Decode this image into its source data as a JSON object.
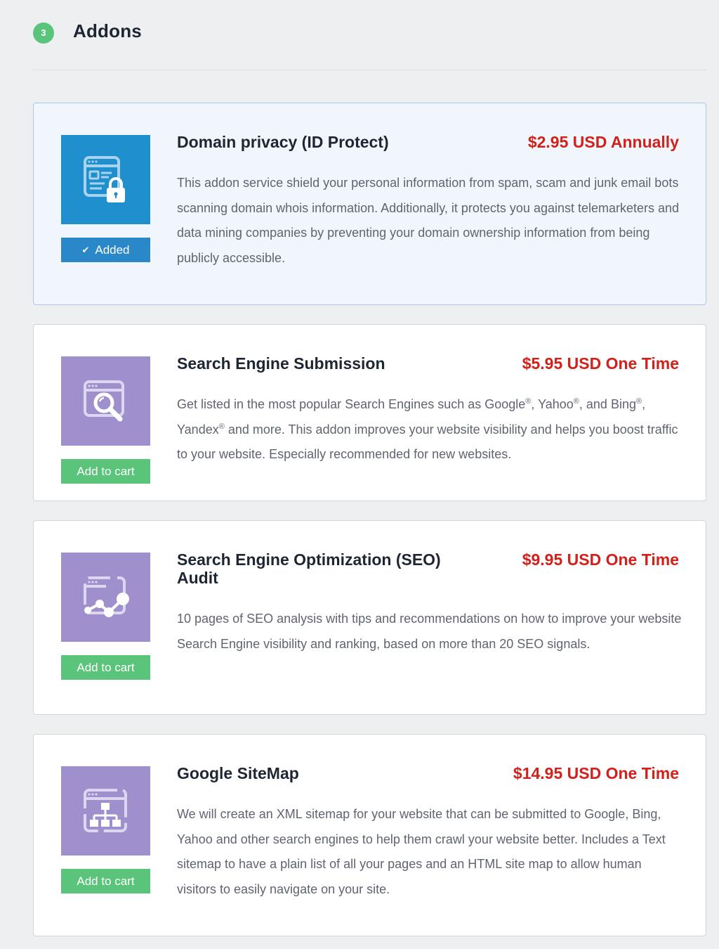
{
  "section": {
    "step": "3",
    "title": "Addons"
  },
  "addons": [
    {
      "name": "Domain privacy (ID Protect)",
      "price": "$2.95 USD Annually",
      "description": "This addon service shield your personal information from spam, scam and junk email bots scanning domain whois information. Additionally, it protects you against telemarketers and data mining companies by preventing your domain ownership information from being publicly accessible.",
      "button": "Added",
      "status": "added",
      "icon": "id-lock-icon",
      "icon_color": "#1f8fce"
    },
    {
      "name": "Search Engine Submission",
      "price": "$5.95 USD One Time",
      "description_parts": {
        "p1": "Get listed in the most popular Search Engines such as Google",
        "r1": "®",
        "p2": ", Yahoo",
        "r2": "®",
        "p3": ", and Bing",
        "r3": "®",
        "p4": ", Yandex",
        "r4": "®",
        "p5": " and more. This addon improves your website visibility and helps you boost traffic to your website. Especially recommended for new websites."
      },
      "button": "Add to cart",
      "status": "not-added",
      "icon": "magnifier-icon",
      "icon_color": "#9f8fcc"
    },
    {
      "name": "Search Engine Optimization (SEO) Audit",
      "price": "$9.95 USD One Time",
      "description": "10 pages of SEO analysis with tips and recommendations on how to improve your website Search Engine visibility and ranking, based on more than 20 SEO signals.",
      "button": "Add to cart",
      "status": "not-added",
      "icon": "graph-nodes-icon",
      "icon_color": "#9f8fcc"
    },
    {
      "name": "Google SiteMap",
      "price": "$14.95 USD One Time",
      "description": "We will create an XML sitemap for your website that can be submitted to Google, Bing, Yahoo and other search engines to help them crawl your website better. Includes a Text sitemap to have a plain list of all your pages and an HTML site map to allow human visitors to easily navigate on your site.",
      "button": "Add to cart",
      "status": "not-added",
      "icon": "sitemap-icon",
      "icon_color": "#9f8fcc"
    }
  ],
  "colors": {
    "price": "#d2201a",
    "added_button": "#2a88c9",
    "add_button": "#5ac57a",
    "step_badge": "#5ac57a",
    "selected_card_bg": "#f0f6fc"
  }
}
